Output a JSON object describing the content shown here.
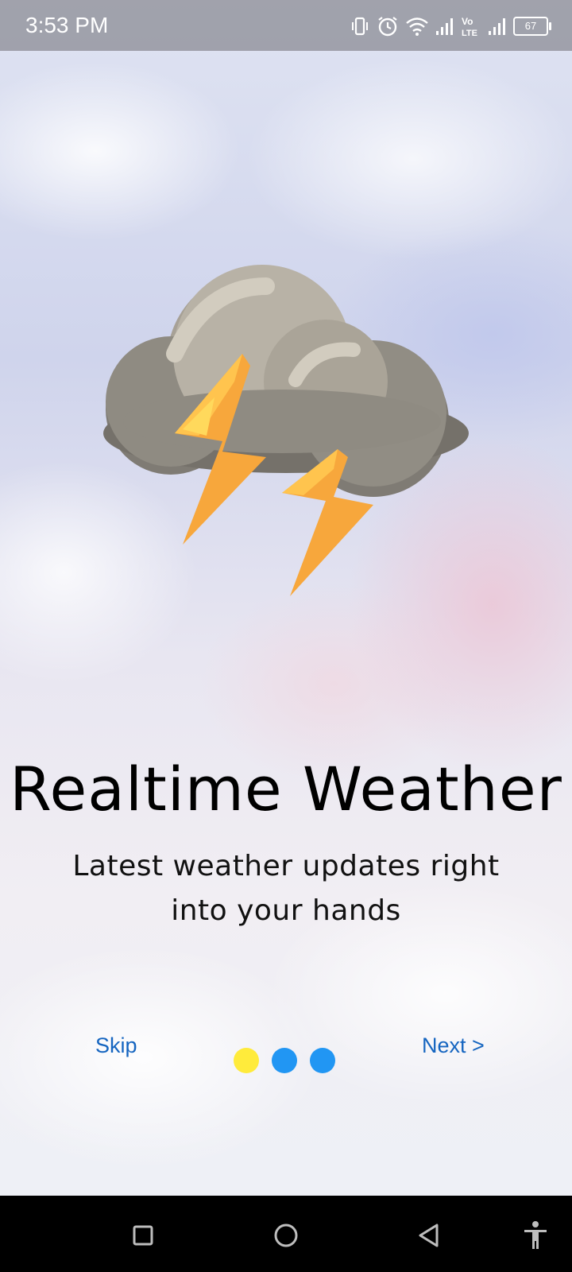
{
  "status_bar": {
    "time": "3:53 PM",
    "battery": "67",
    "icons": [
      "vibrate-icon",
      "alarm-icon",
      "wifi-icon",
      "signal-icon",
      "volte-icon",
      "signal-icon",
      "battery-icon"
    ]
  },
  "onboarding": {
    "title": "Realtime Weather",
    "subtitle": "Latest weather updates right into your hands",
    "skip_label": "Skip",
    "next_label": "Next >",
    "page_indicator": {
      "total": 3,
      "current": 1,
      "active_color": "#ffeb3b",
      "inactive_color": "#2196f3"
    },
    "illustration": "thunderstorm-cloud-icon"
  },
  "nav_bar": {
    "buttons": [
      "recent-apps-icon",
      "home-icon",
      "back-icon",
      "accessibility-icon"
    ]
  },
  "colors": {
    "link": "#1565c0",
    "title": "#000000"
  }
}
